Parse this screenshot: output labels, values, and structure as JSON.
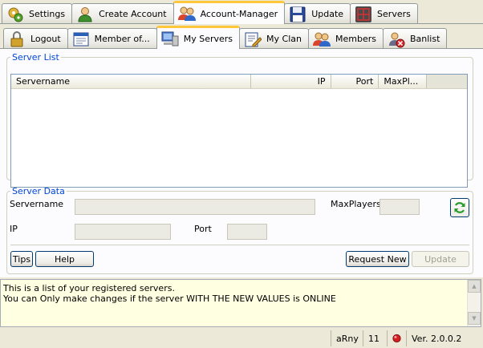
{
  "top_tabs": [
    {
      "label": "Settings",
      "icon": "settings-icon"
    },
    {
      "label": "Create Account",
      "icon": "user-icon"
    },
    {
      "label": "Account-Manager",
      "icon": "users-icon",
      "active": true
    },
    {
      "label": "Update",
      "icon": "floppy-icon"
    },
    {
      "label": "Servers",
      "icon": "server-grid-icon"
    }
  ],
  "sub_tabs": [
    {
      "label": "Logout",
      "icon": "lock-icon"
    },
    {
      "label": "Member of...",
      "icon": "window-icon"
    },
    {
      "label": "My Servers",
      "icon": "computer-icon",
      "active": true
    },
    {
      "label": "My Clan",
      "icon": "edit-doc-icon"
    },
    {
      "label": "Members",
      "icon": "users-icon"
    },
    {
      "label": "Banlist",
      "icon": "ban-user-icon"
    }
  ],
  "server_list": {
    "legend": "Server List",
    "columns": [
      "Servername",
      "IP",
      "Port",
      "MaxPl..."
    ],
    "rows": []
  },
  "server_data": {
    "legend": "Server Data",
    "servername_label": "Servername",
    "maxplayers_label": "MaxPlayers",
    "ip_label": "IP",
    "port_label": "Port",
    "servername_value": "",
    "maxplayers_value": "",
    "ip_value": "",
    "port_value": ""
  },
  "buttons": {
    "tips": "Tips",
    "help": "Help",
    "request_new": "Request New",
    "update": "Update"
  },
  "info": {
    "line1": "This is a list of your registered servers.",
    "line2": "You can Only make changes if the server WITH THE NEW VALUES is ONLINE"
  },
  "status": {
    "user": "aRny",
    "count": "11",
    "indicator_color": "#d42020",
    "version": "Ver. 2.0.0.2"
  },
  "colors": {
    "accent_tab": "#ffc83c",
    "legend": "#0046d5",
    "info_bg": "#ffffe1"
  }
}
